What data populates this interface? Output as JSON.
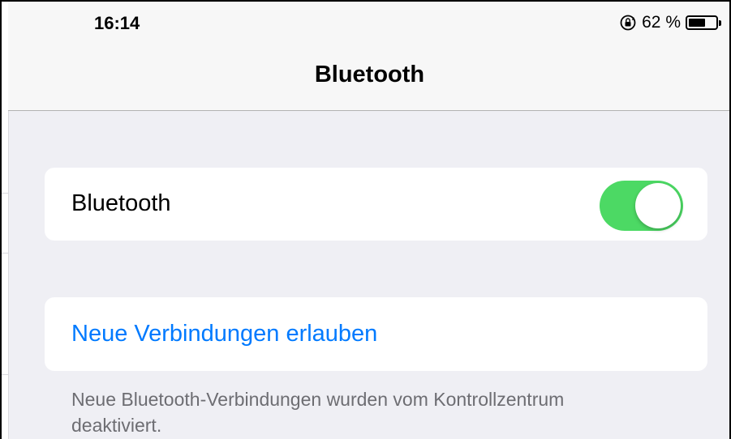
{
  "status_bar": {
    "time": "16:14",
    "battery_percent_label": "62 %",
    "battery_level": 0.62,
    "icons": [
      "orientation-lock-icon",
      "battery-icon"
    ]
  },
  "nav": {
    "title": "Bluetooth"
  },
  "bluetooth_cell": {
    "label": "Bluetooth",
    "toggle_on": true,
    "toggle_color": "#4cd964"
  },
  "allow_cell": {
    "link_label": "Neue Verbindungen erlauben",
    "link_color": "#007aff"
  },
  "footer": {
    "note_line1": "Neue Bluetooth-Verbindungen wurden vom Kontrollzentrum",
    "note_line2": "deaktiviert."
  }
}
